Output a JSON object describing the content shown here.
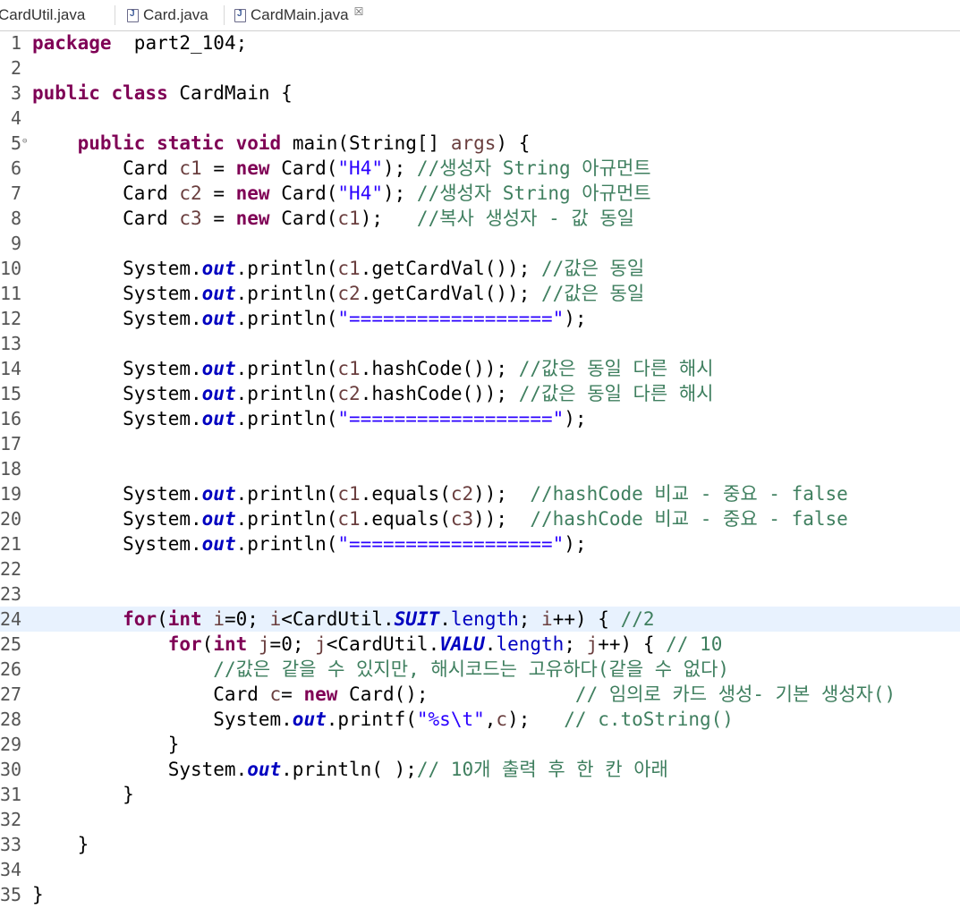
{
  "tabs": [
    {
      "label": "CardUtil.java",
      "active": false
    },
    {
      "label": "Card.java",
      "active": false
    },
    {
      "label": "CardMain.java",
      "active": true
    }
  ],
  "close_glyph": "☒",
  "editor": {
    "current_line": 24,
    "lines": [
      {
        "n": "1",
        "tokens": [
          [
            "kw",
            "package"
          ],
          [
            "",
            "  part2_104;"
          ]
        ]
      },
      {
        "n": "2",
        "tokens": []
      },
      {
        "n": "3",
        "tokens": [
          [
            "kw",
            "public"
          ],
          [
            "",
            ""
          ],
          [
            "kw",
            " class"
          ],
          [
            "",
            " CardMain {"
          ]
        ]
      },
      {
        "n": "4",
        "tokens": []
      },
      {
        "n": "5",
        "fold": "⊖",
        "tokens": [
          [
            "",
            "    "
          ],
          [
            "kw",
            "public"
          ],
          [
            "kw",
            " static"
          ],
          [
            "kw",
            " void"
          ],
          [
            "",
            " main(String[] "
          ],
          [
            "vr",
            "args"
          ],
          [
            "",
            ") {"
          ]
        ]
      },
      {
        "n": "6",
        "tokens": [
          [
            "",
            "        Card "
          ],
          [
            "vr",
            "c1"
          ],
          [
            "",
            " = "
          ],
          [
            "kw",
            "new"
          ],
          [
            "",
            " Card("
          ],
          [
            "st",
            "\"H4\""
          ],
          [
            "",
            "); "
          ],
          [
            "cm",
            "//생성자 String 아규먼트"
          ]
        ]
      },
      {
        "n": "7",
        "tokens": [
          [
            "",
            "        Card "
          ],
          [
            "vr",
            "c2"
          ],
          [
            "",
            " = "
          ],
          [
            "kw",
            "new"
          ],
          [
            "",
            " Card("
          ],
          [
            "st",
            "\"H4\""
          ],
          [
            "",
            "); "
          ],
          [
            "cm",
            "//생성자 String 아규먼트"
          ]
        ]
      },
      {
        "n": "8",
        "tokens": [
          [
            "",
            "        Card "
          ],
          [
            "vr",
            "c3"
          ],
          [
            "",
            " = "
          ],
          [
            "kw",
            "new"
          ],
          [
            "",
            " Card("
          ],
          [
            "vr",
            "c1"
          ],
          [
            "",
            ");   "
          ],
          [
            "cm",
            "//복사 생성자 - 값 동일"
          ]
        ]
      },
      {
        "n": "9",
        "tokens": []
      },
      {
        "n": "10",
        "tokens": [
          [
            "",
            "        System."
          ],
          [
            "fd",
            "out"
          ],
          [
            "",
            ".println("
          ],
          [
            "vr",
            "c1"
          ],
          [
            "",
            ".getCardVal()); "
          ],
          [
            "cm",
            "//값은 동일"
          ]
        ]
      },
      {
        "n": "11",
        "tokens": [
          [
            "",
            "        System."
          ],
          [
            "fd",
            "out"
          ],
          [
            "",
            ".println("
          ],
          [
            "vr",
            "c2"
          ],
          [
            "",
            ".getCardVal()); "
          ],
          [
            "cm",
            "//값은 동일"
          ]
        ]
      },
      {
        "n": "12",
        "tokens": [
          [
            "",
            "        System."
          ],
          [
            "fd",
            "out"
          ],
          [
            "",
            ".println("
          ],
          [
            "st",
            "\"==================\""
          ],
          [
            "",
            ");"
          ]
        ]
      },
      {
        "n": "13",
        "tokens": []
      },
      {
        "n": "14",
        "tokens": [
          [
            "",
            "        System."
          ],
          [
            "fd",
            "out"
          ],
          [
            "",
            ".println("
          ],
          [
            "vr",
            "c1"
          ],
          [
            "",
            ".hashCode()); "
          ],
          [
            "cm",
            "//값은 동일 다른 해시"
          ]
        ]
      },
      {
        "n": "15",
        "tokens": [
          [
            "",
            "        System."
          ],
          [
            "fd",
            "out"
          ],
          [
            "",
            ".println("
          ],
          [
            "vr",
            "c2"
          ],
          [
            "",
            ".hashCode()); "
          ],
          [
            "cm",
            "//값은 동일 다른 해시"
          ]
        ]
      },
      {
        "n": "16",
        "tokens": [
          [
            "",
            "        System."
          ],
          [
            "fd",
            "out"
          ],
          [
            "",
            ".println("
          ],
          [
            "st",
            "\"==================\""
          ],
          [
            "",
            ");"
          ]
        ]
      },
      {
        "n": "17",
        "tokens": []
      },
      {
        "n": "18",
        "tokens": []
      },
      {
        "n": "19",
        "tokens": [
          [
            "",
            "        System."
          ],
          [
            "fd",
            "out"
          ],
          [
            "",
            ".println("
          ],
          [
            "vr",
            "c1"
          ],
          [
            "",
            ".equals("
          ],
          [
            "vr",
            "c2"
          ],
          [
            "",
            "));  "
          ],
          [
            "cm",
            "//hashCode 비교 - 중요 - false"
          ]
        ]
      },
      {
        "n": "20",
        "tokens": [
          [
            "",
            "        System."
          ],
          [
            "fd",
            "out"
          ],
          [
            "",
            ".println("
          ],
          [
            "vr",
            "c1"
          ],
          [
            "",
            ".equals("
          ],
          [
            "vr",
            "c3"
          ],
          [
            "",
            "));  "
          ],
          [
            "cm",
            "//hashCode 비교 - 중요 - false"
          ]
        ]
      },
      {
        "n": "21",
        "tokens": [
          [
            "",
            "        System."
          ],
          [
            "fd",
            "out"
          ],
          [
            "",
            ".println("
          ],
          [
            "st",
            "\"==================\""
          ],
          [
            "",
            ");"
          ]
        ]
      },
      {
        "n": "22",
        "tokens": []
      },
      {
        "n": "23",
        "tokens": []
      },
      {
        "n": "24",
        "tokens": [
          [
            "",
            "        "
          ],
          [
            "kw",
            "for"
          ],
          [
            "",
            "("
          ],
          [
            "kw",
            "int"
          ],
          [
            "",
            ""
          ],
          [
            "vr",
            " i"
          ],
          [
            "",
            "=0; "
          ],
          [
            "vr",
            "i"
          ],
          [
            "",
            "<CardUtil."
          ],
          [
            "fd",
            "SUIT"
          ],
          [
            "",
            "."
          ],
          [
            "fn",
            "length"
          ],
          [
            "",
            "; "
          ],
          [
            "vr",
            "i"
          ],
          [
            "",
            "++) { "
          ],
          [
            "cm",
            "//2"
          ]
        ]
      },
      {
        "n": "25",
        "tokens": [
          [
            "",
            "            "
          ],
          [
            "kw",
            "for"
          ],
          [
            "",
            "("
          ],
          [
            "kw",
            "int"
          ],
          [
            "vr",
            " j"
          ],
          [
            "",
            "=0; "
          ],
          [
            "vr",
            "j"
          ],
          [
            "",
            "<CardUtil."
          ],
          [
            "fd",
            "VALU"
          ],
          [
            "",
            "."
          ],
          [
            "fn",
            "length"
          ],
          [
            "",
            "; "
          ],
          [
            "vr",
            "j"
          ],
          [
            "",
            "++) { "
          ],
          [
            "cm",
            "// 10"
          ]
        ]
      },
      {
        "n": "26",
        "tokens": [
          [
            "",
            "                "
          ],
          [
            "cm",
            "//값은 같을 수 있지만, 해시코드는 고유하다(같을 수 없다)"
          ]
        ]
      },
      {
        "n": "27",
        "tokens": [
          [
            "",
            "                Card "
          ],
          [
            "vr",
            "c"
          ],
          [
            "",
            "= "
          ],
          [
            "kw",
            "new"
          ],
          [
            "",
            " Card();             "
          ],
          [
            "cm",
            "// 임의로 카드 생성- 기본 생성자()"
          ]
        ]
      },
      {
        "n": "28",
        "tokens": [
          [
            "",
            "                System."
          ],
          [
            "fd",
            "out"
          ],
          [
            "",
            ".printf("
          ],
          [
            "st",
            "\"%s\\t\""
          ],
          [
            "",
            ","
          ],
          [
            "vr",
            "c"
          ],
          [
            "",
            ");   "
          ],
          [
            "cm",
            "// c.toString()"
          ]
        ]
      },
      {
        "n": "29",
        "tokens": [
          [
            "",
            "            }"
          ]
        ]
      },
      {
        "n": "30",
        "tokens": [
          [
            "",
            "            System."
          ],
          [
            "fd",
            "out"
          ],
          [
            "",
            ".println( );"
          ],
          [
            "cm",
            "// 10개 출력 후 한 칸 아래"
          ]
        ]
      },
      {
        "n": "31",
        "tokens": [
          [
            "",
            "        }"
          ]
        ]
      },
      {
        "n": "32",
        "tokens": []
      },
      {
        "n": "33",
        "tokens": [
          [
            "",
            "    }"
          ]
        ]
      },
      {
        "n": "34",
        "tokens": []
      },
      {
        "n": "35",
        "tokens": [
          [
            "",
            "}"
          ]
        ]
      }
    ]
  }
}
